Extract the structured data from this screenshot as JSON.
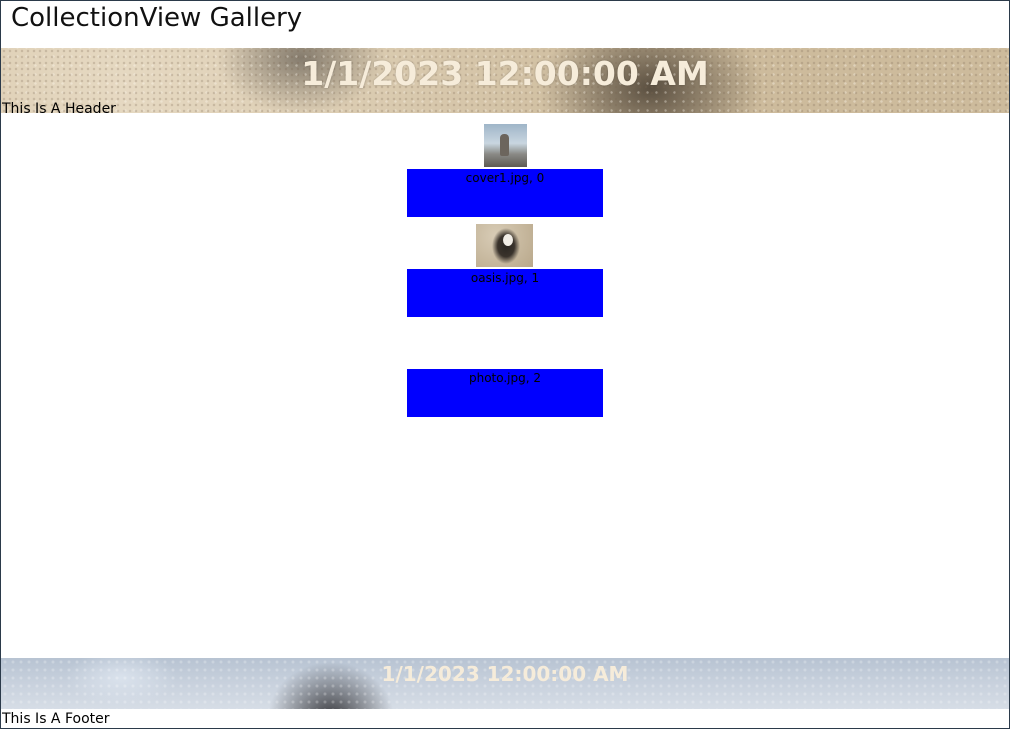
{
  "page": {
    "title": "CollectionView Gallery"
  },
  "header": {
    "date": "1/1/2023 12:00:00 AM",
    "label": "This Is A Header"
  },
  "items": [
    {
      "image": "cover1.jpg",
      "caption": "cover1.jpg, 0"
    },
    {
      "image": "oasis.jpg",
      "caption": "oasis.jpg, 1"
    },
    {
      "image": "photo.jpg",
      "caption": "photo.jpg, 2"
    }
  ],
  "footer": {
    "date": "1/1/2023 12:00:00 AM",
    "label": "This Is A Footer"
  },
  "colors": {
    "item_background": "#0000ff",
    "banner_text": "#f6ecda"
  }
}
